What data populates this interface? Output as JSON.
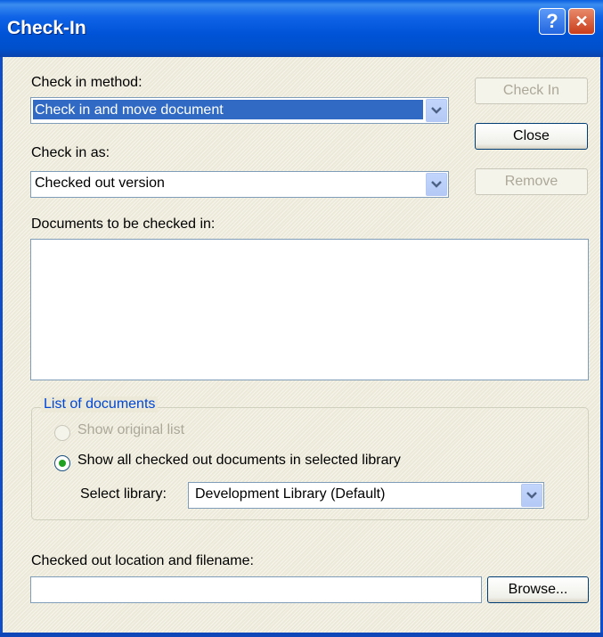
{
  "window": {
    "title": "Check-In",
    "help_glyph": "?",
    "close_glyph": "✕"
  },
  "check_in_method": {
    "label": "Check in method:",
    "value": "Check in and move document"
  },
  "check_in_as": {
    "label": "Check in as:",
    "value": "Checked out version"
  },
  "documents": {
    "label": "Documents to be checked in:",
    "items": []
  },
  "buttons": {
    "check_in": "Check In",
    "close": "Close",
    "remove": "Remove",
    "browse": "Browse..."
  },
  "list_of_documents": {
    "legend": "List of documents",
    "option_original": "Show original list",
    "option_all": "Show all checked out documents in selected library",
    "selected_option": "option_all",
    "select_library_label": "Select library:",
    "library_value": "Development Library  (Default)"
  },
  "checked_out_location": {
    "label": "Checked out location and filename:",
    "value": ""
  },
  "colors": {
    "titlebar": "#0053d6",
    "face": "#ece9d8",
    "selection": "#316ac5",
    "group_legend": "#0046d5"
  },
  "icons": {
    "dropdown": "chevron-down-icon",
    "help": "help-icon",
    "close": "close-icon"
  }
}
